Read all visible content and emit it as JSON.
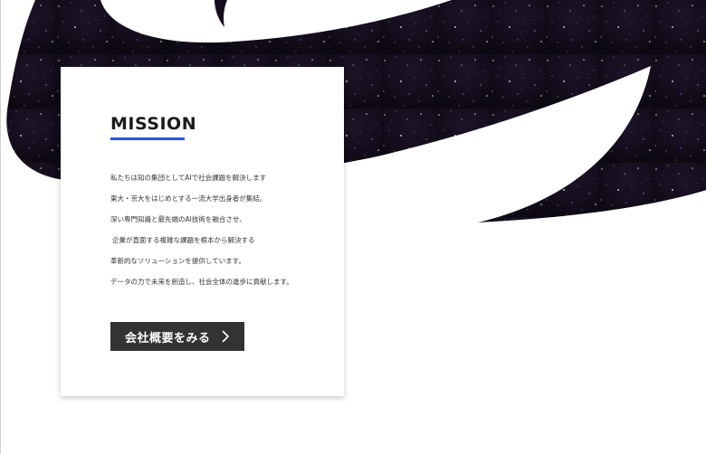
{
  "mission": {
    "title": "MISSION",
    "lines": [
      "私たちは知の集団としてAIで社会課題を解決します",
      "東大・京大をはじめとする一流大学出身者が集結。",
      "深い専門知識と最先端のAI技術を融合させ、",
      "企業が直面する複雑な課題を根本から解決する",
      "革新的なソリューションを提供しています。",
      "データの力で未来を創造し、社会全体の進歩に貢献します。"
    ],
    "button_label": "会社概要をみる"
  },
  "icons": {
    "button_icon": "chevron-right-icon",
    "background": "starfield-swoosh"
  },
  "colors": {
    "accent": "#2b53e0",
    "button_bg": "#333333",
    "night_sky": "#140d1c"
  }
}
